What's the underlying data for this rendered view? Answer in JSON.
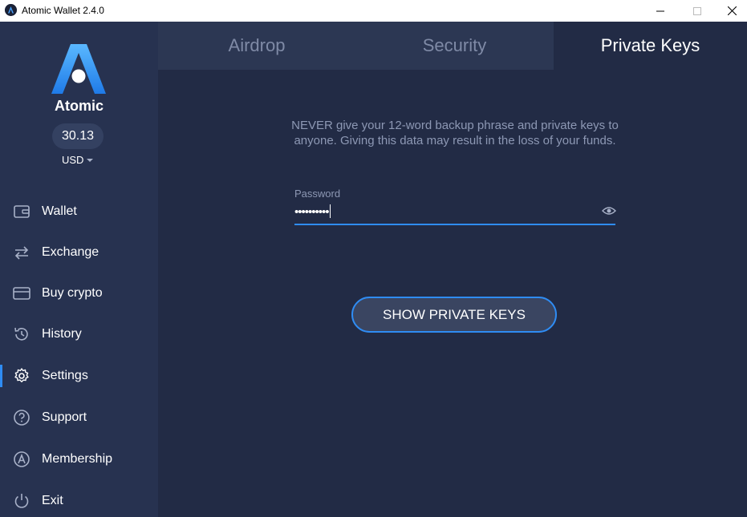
{
  "window": {
    "title": "Atomic Wallet 2.4.0",
    "controls": [
      "minimize-icon",
      "maximize-icon",
      "close-icon"
    ]
  },
  "sidebar": {
    "brand": "Atomic",
    "balance": "30.13",
    "currency": "USD",
    "items": [
      {
        "label": "Wallet",
        "icon": "wallet-icon"
      },
      {
        "label": "Exchange",
        "icon": "exchange-icon"
      },
      {
        "label": "Buy crypto",
        "icon": "card-icon"
      },
      {
        "label": "History",
        "icon": "history-icon"
      },
      {
        "label": "Settings",
        "icon": "gear-icon",
        "active": true
      },
      {
        "label": "Support",
        "icon": "question-icon"
      },
      {
        "label": "Membership",
        "icon": "atomic-logo-icon"
      },
      {
        "label": "Exit",
        "icon": "power-icon"
      }
    ]
  },
  "tabs": [
    {
      "label": "Airdrop"
    },
    {
      "label": "Security"
    },
    {
      "label": "Private Keys",
      "active": true
    }
  ],
  "content": {
    "warning": "NEVER give your 12-word backup phrase and private keys to anyone. Giving this data may result in the loss of your funds.",
    "password_label": "Password",
    "password_value": "••••••••••",
    "button_label": "SHOW PRIVATE KEYS"
  },
  "colors": {
    "accent": "#2f8cf3",
    "sidebar_bg": "#273250",
    "content_bg": "#222b45",
    "tabbar_bg": "#2c3753"
  }
}
